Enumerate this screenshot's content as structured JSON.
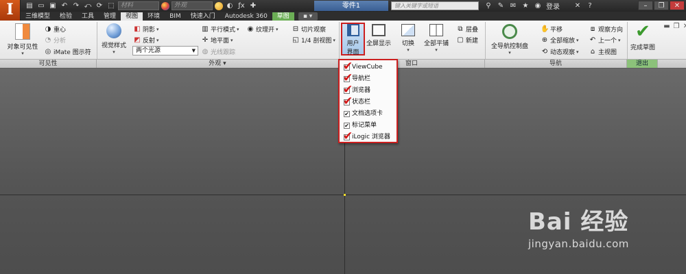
{
  "qat": {
    "material_placeholder": "材料",
    "appearance_placeholder": "外观"
  },
  "document_title": "零件1",
  "search": {
    "placeholder": "键入关键字或短语"
  },
  "user": {
    "login_label": "登录"
  },
  "tabs": [
    {
      "label": "三维模型",
      "active": false
    },
    {
      "label": "检验",
      "active": false
    },
    {
      "label": "工具",
      "active": false
    },
    {
      "label": "管理",
      "active": false
    },
    {
      "label": "视图",
      "active": true
    },
    {
      "label": "环境",
      "active": false
    },
    {
      "label": "BIM",
      "active": false
    },
    {
      "label": "快速入门",
      "active": false
    },
    {
      "label": "Autodesk 360",
      "active": false
    },
    {
      "label": "草图",
      "active": false,
      "contextual": true
    }
  ],
  "ribbon": {
    "visibility": {
      "object_visibility": "对象可见性",
      "center_of_gravity": "重心",
      "analysis": "分析",
      "imate_glyph": "iMate 图示符"
    },
    "appearance": {
      "visual_style": "视觉样式",
      "shadows": "阴影",
      "reflections": "反射",
      "lighting_select": "两个光源",
      "parallel_mode": "平行模式",
      "ground_plane": "地平面",
      "ray_tracing": "光线跟踪",
      "texture_on": "纹理开",
      "slice_graphics": "切片观察",
      "quarter_section": "1/4 剖视图"
    },
    "window": {
      "user_interface_line1": "用户",
      "user_interface_line2": "界面",
      "full_screen": "全屏显示",
      "switch": "切换",
      "tile_all": "全部平铺",
      "cascade": "层叠",
      "new_window": "新建"
    },
    "navigate": {
      "full_navigation_wheel": "全导航控制盘",
      "pan": "平移",
      "zoom_all": "全部缩放",
      "orbit": "动态观察",
      "view_face": "观察方向",
      "previous": "上一个",
      "home_view": "主视图"
    },
    "exit": {
      "finish_sketch": "完成草图"
    }
  },
  "panel_labels": {
    "visibility": "可见性",
    "appearance": "外观 ▾",
    "window": "窗口",
    "navigate": "导航",
    "exit": "退出"
  },
  "user_interface_menu": [
    {
      "label": "ViewCube",
      "checked": true,
      "red_mark": true
    },
    {
      "label": "导航栏",
      "checked": true,
      "red_mark": true
    },
    {
      "label": "浏览器",
      "checked": true,
      "red_mark": true
    },
    {
      "label": "状态栏",
      "checked": true,
      "red_mark": true
    },
    {
      "label": "文档选项卡",
      "checked": true,
      "red_mark": false
    },
    {
      "label": "标记菜单",
      "checked": true,
      "red_mark": false
    },
    {
      "label": "iLogic 浏览器",
      "checked": true,
      "red_mark": true
    }
  ],
  "watermark": {
    "main": "Bai 经验",
    "sub": "jingyan.baidu.com"
  },
  "colors": {
    "app_orange": "#c94b12",
    "highlight_red": "#cc1f1f",
    "sketch_tab_green": "#6bae55",
    "viewport_gray": "#5d5d5d"
  }
}
